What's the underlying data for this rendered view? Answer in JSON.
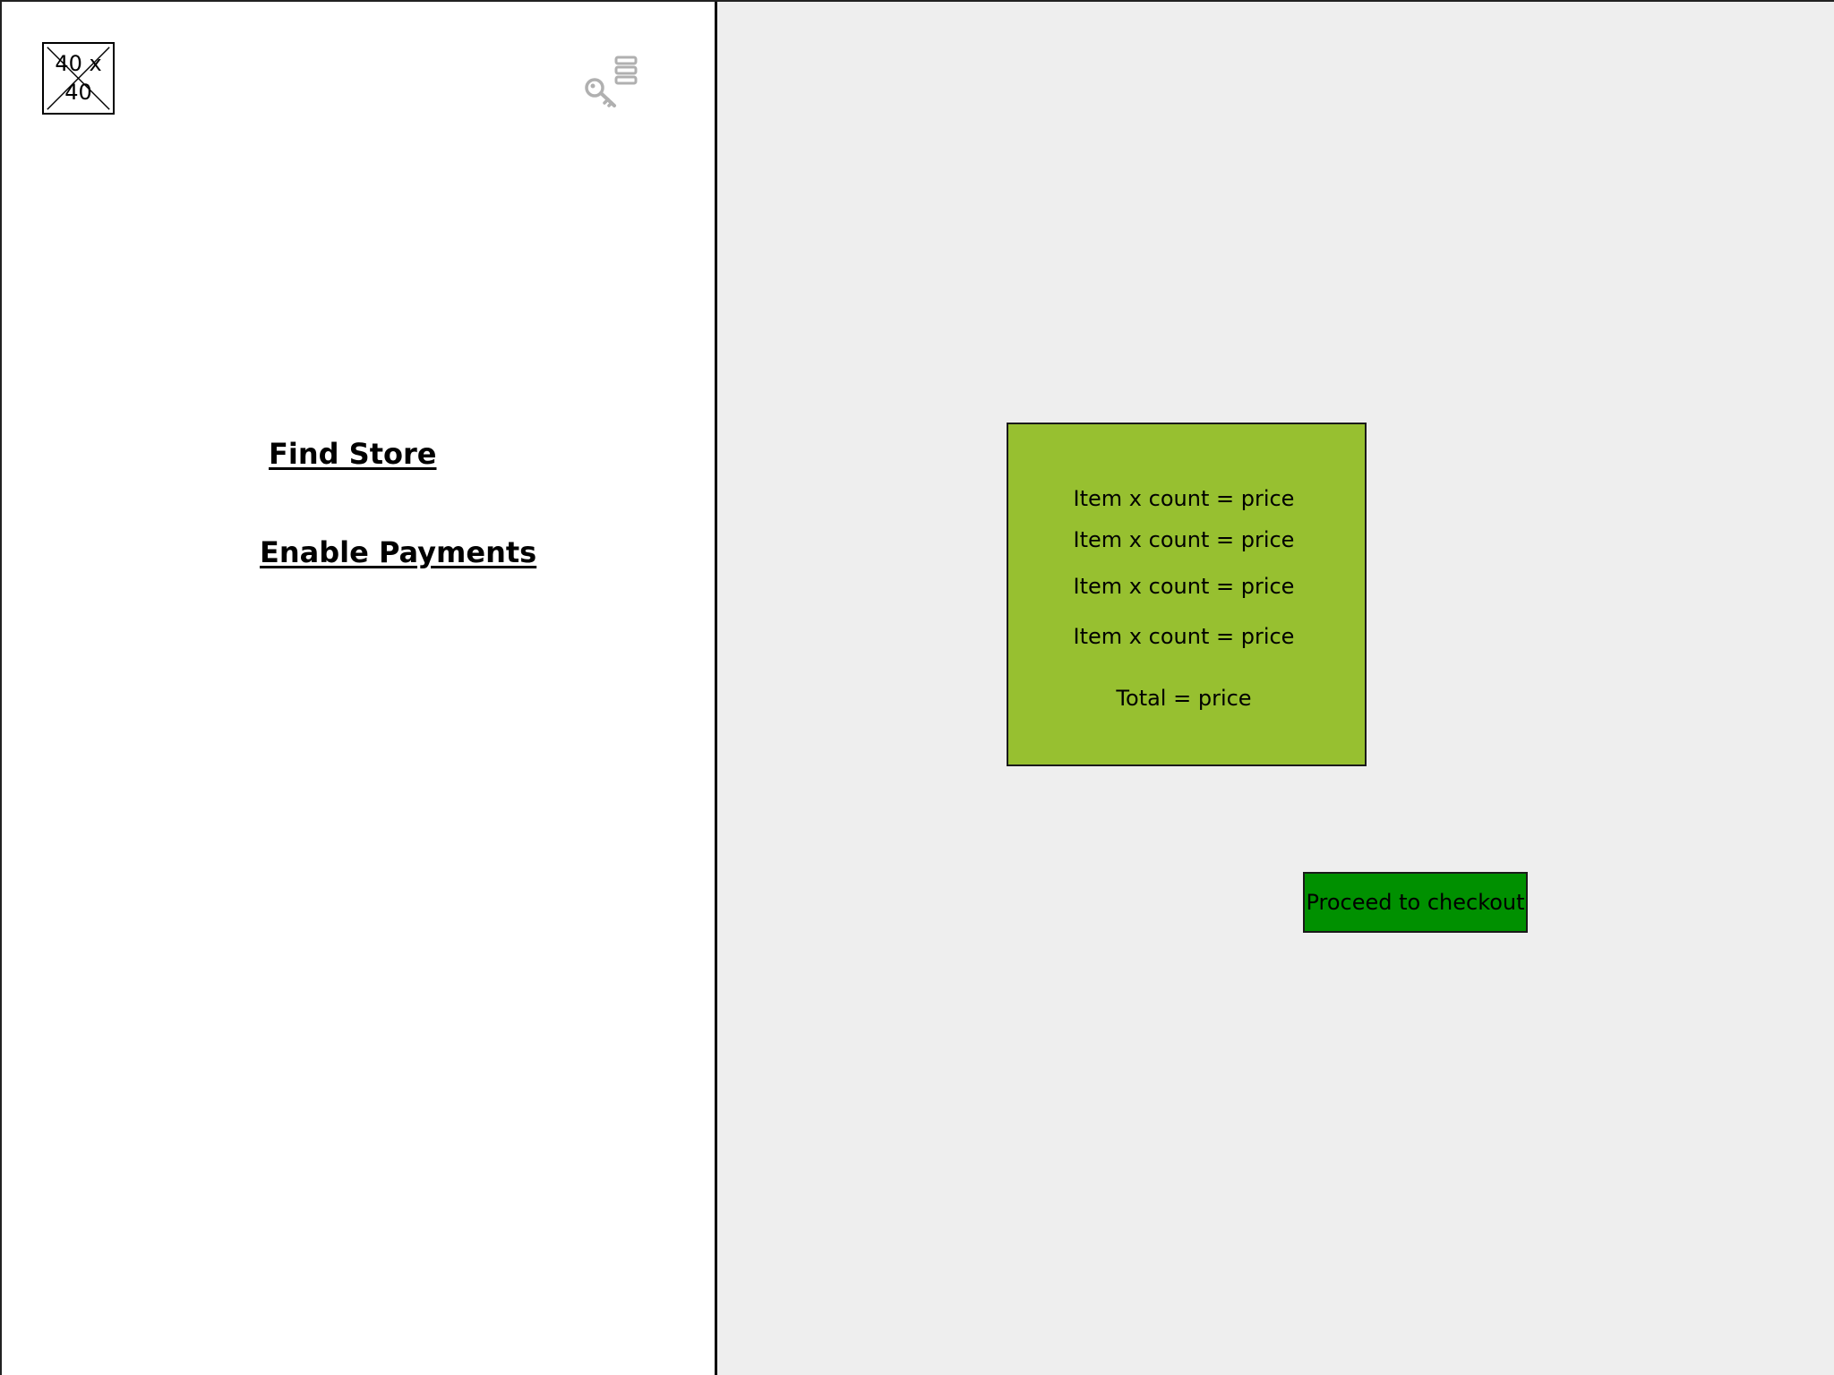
{
  "logo": {
    "placeholder_text": "40 x 40",
    "icon": "image-placeholder"
  },
  "header": {
    "key_icon": "key-settings-icon"
  },
  "sidebar": {
    "links": [
      {
        "label": "Find Store"
      },
      {
        "label": "Enable Payments"
      }
    ]
  },
  "summary": {
    "lines": [
      "Item x count = price",
      "Item x count = price",
      "Item x count = price",
      "Item x count = price"
    ],
    "total": "Total = price",
    "background_color": "#97c030"
  },
  "checkout": {
    "label": "Proceed to checkout",
    "color": "#009000"
  },
  "colors": {
    "main_background": "#eeeeee",
    "sidebar_background": "#ffffff"
  }
}
